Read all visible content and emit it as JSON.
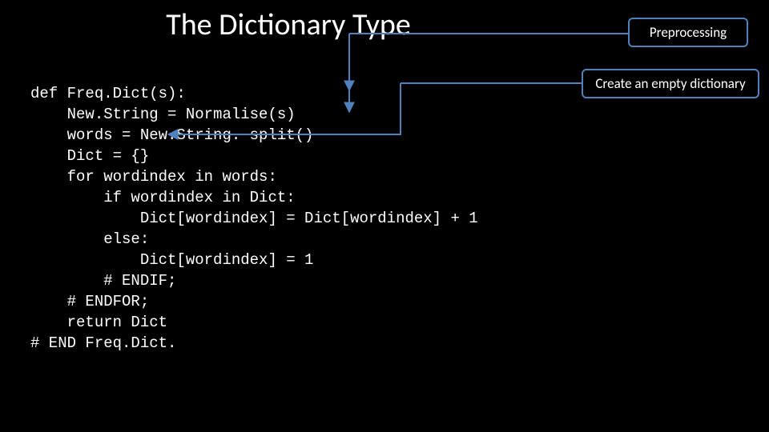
{
  "title": "The Dictionary Type",
  "callout1": "Preprocessing",
  "callout2": "Create an empty dictionary",
  "code": {
    "l1": "def Freq.Dict(s):",
    "l2": "    New.String = Normalise(s)",
    "l3": "    words = New.String. split()",
    "l4": "    Dict = {}",
    "l5": "    for wordindex in words:",
    "l6": "        if wordindex in Dict:",
    "l7": "            Dict[wordindex] = Dict[wordindex] + 1",
    "l8": "        else:",
    "l9": "            Dict[wordindex] = 1",
    "l10": "        # ENDIF;",
    "l11": "    # ENDFOR;",
    "l12": "    return Dict",
    "l13": "# END Freq.Dict."
  }
}
